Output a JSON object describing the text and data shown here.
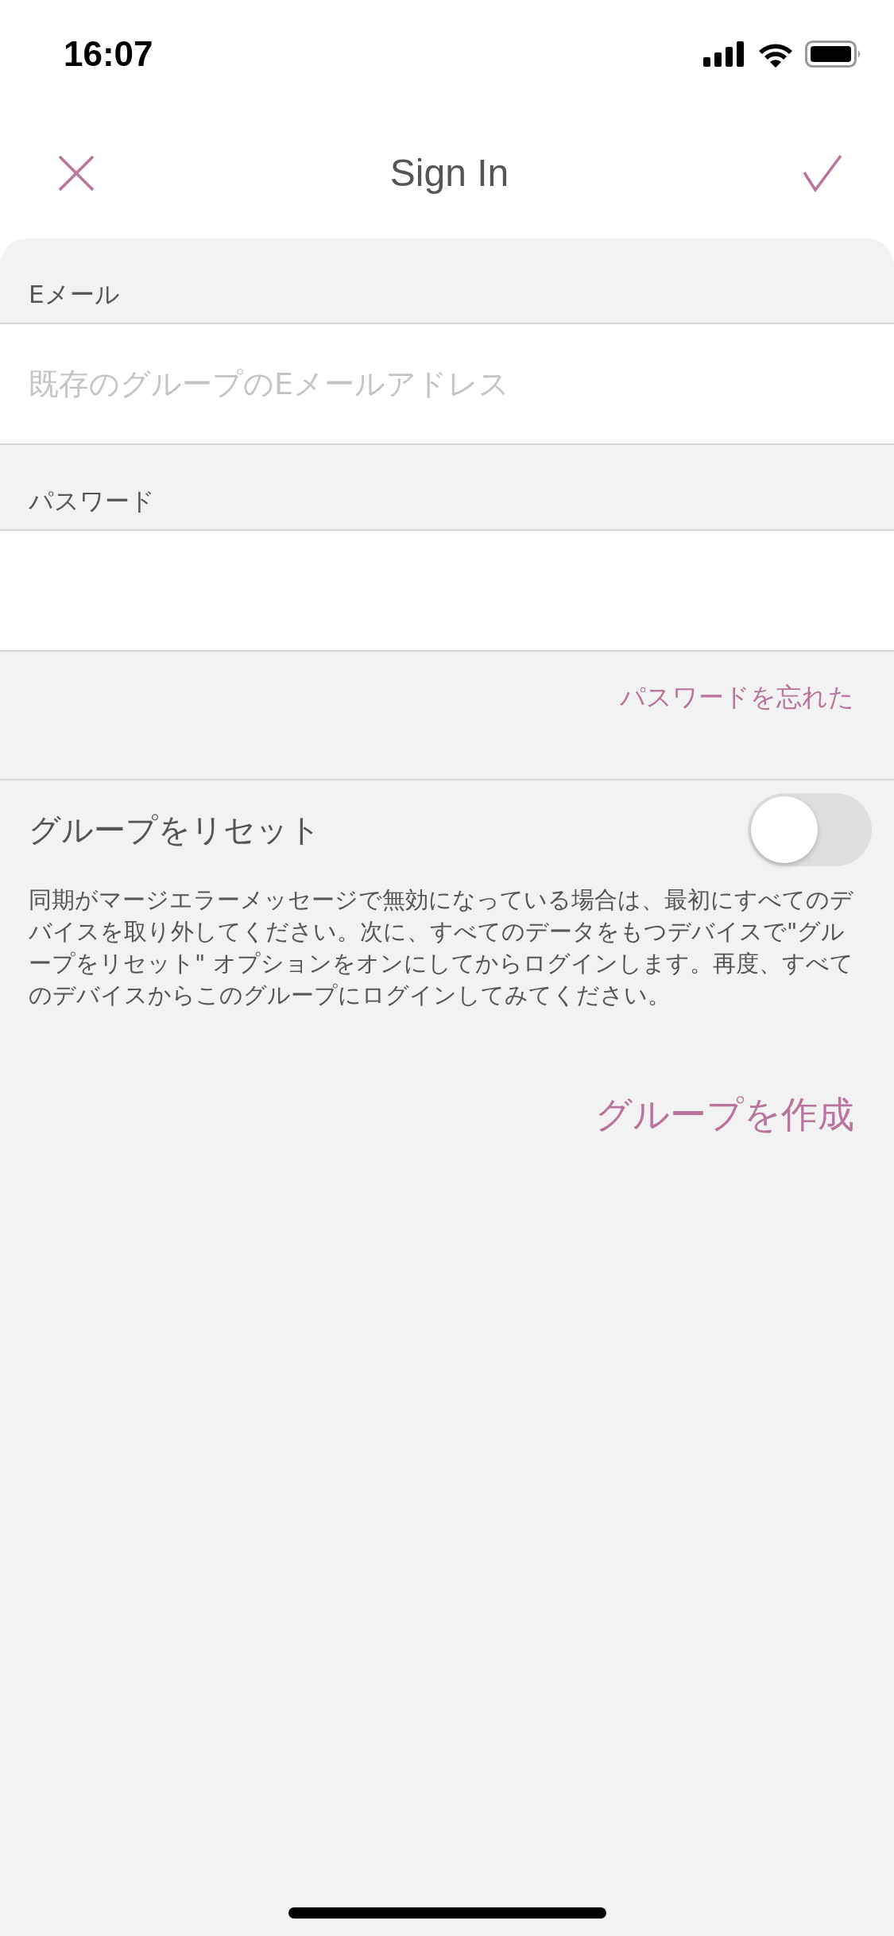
{
  "status_bar": {
    "time": "16:07"
  },
  "nav": {
    "title": "Sign In"
  },
  "fields": [
    {
      "label": "Eメール",
      "placeholder": "既存のグループのEメールアドレス"
    },
    {
      "label": "パスワード"
    }
  ],
  "forgot_link": "パスワードを忘れた",
  "reset": {
    "label": "グループをリセット",
    "on": false,
    "description": "同期がマージエラーメッセージで無効になっている場合は、最初にすべてのデバイスを取り外してください。次に、すべてのデータをもつデバイスで\"グループをリセット\" オプションをオンにしてからログインします。再度、すべてのデバイスからこのグループにログインしてみてください。"
  },
  "create_link": "グループを作成"
}
